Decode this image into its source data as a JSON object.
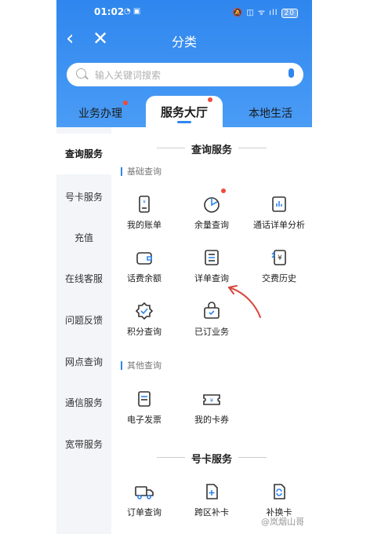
{
  "status": {
    "time": "01:02",
    "battery": "20"
  },
  "nav": {
    "back_icon": "back-arrow-icon",
    "close_icon": "close-icon",
    "title": "分类"
  },
  "search": {
    "placeholder": "输入关键词搜索"
  },
  "tabs": [
    {
      "label": "业务办理",
      "badge": true
    },
    {
      "label": "服务大厅",
      "badge": true,
      "active": true
    },
    {
      "label": "本地生活",
      "badge": false
    }
  ],
  "sidebar": {
    "items": [
      {
        "label": "查询服务",
        "selected": true
      },
      {
        "label": "号卡服务"
      },
      {
        "label": "充值"
      },
      {
        "label": "在线客服"
      },
      {
        "label": "问题反馈"
      },
      {
        "label": "网点查询"
      },
      {
        "label": "通信服务"
      },
      {
        "label": "宽带服务"
      }
    ]
  },
  "content": {
    "section1": {
      "title": "查询服务",
      "group1": {
        "title": "基础查询",
        "items": [
          {
            "label": "我的账单",
            "icon": "bill-icon"
          },
          {
            "label": "余量查询",
            "icon": "pie-chart-icon",
            "badge": true
          },
          {
            "label": "通话详单分析",
            "icon": "chart-doc-icon"
          },
          {
            "label": "话费余额",
            "icon": "wallet-icon"
          },
          {
            "label": "详单查询",
            "icon": "list-doc-icon"
          },
          {
            "label": "交费历史",
            "icon": "yen-receipt-icon"
          },
          {
            "label": "积分查询",
            "icon": "points-icon"
          },
          {
            "label": "已订业务",
            "icon": "bag-icon"
          }
        ]
      },
      "group2": {
        "title": "其他查询",
        "items": [
          {
            "label": "电子发票",
            "icon": "invoice-icon"
          },
          {
            "label": "我的卡券",
            "icon": "coupon-icon"
          }
        ]
      }
    },
    "section2": {
      "title": "号卡服务",
      "items": [
        {
          "label": "订单查询",
          "icon": "truck-icon"
        },
        {
          "label": "跨区补卡",
          "icon": "sim-add-icon"
        },
        {
          "label": "补换卡",
          "icon": "sim-swap-icon"
        }
      ]
    }
  },
  "watermark": "@岚烟山哥",
  "colors": {
    "primary": "#2f86ee",
    "badge": "#ef4b3c",
    "annotation": "#d9463a"
  }
}
